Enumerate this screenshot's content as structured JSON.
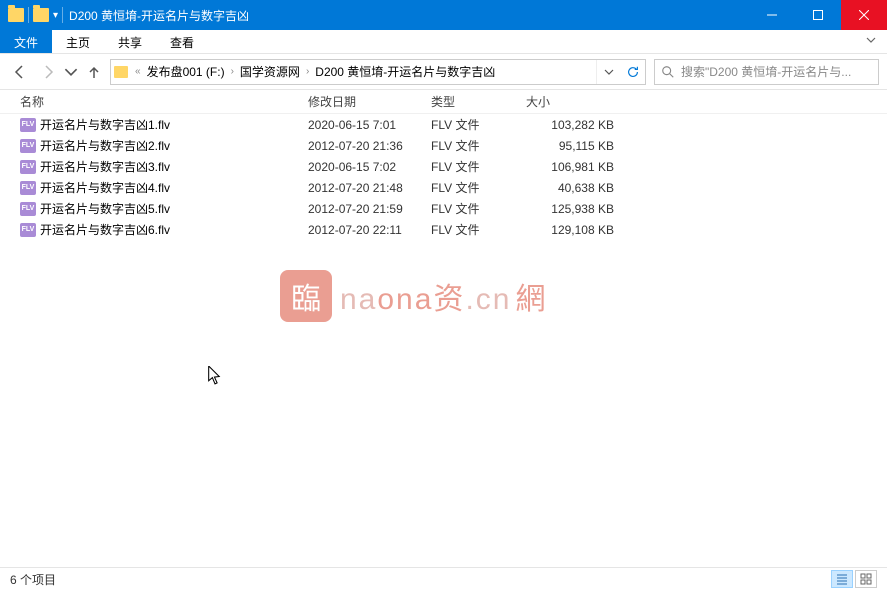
{
  "window": {
    "title": "D200 黄恒堉-开运名片与数字吉凶"
  },
  "tabs": {
    "file": "文件",
    "home": "主页",
    "share": "共享",
    "view": "查看"
  },
  "breadcrumb": {
    "prefix": "«",
    "items": [
      "发布盘001 (F:)",
      "国学资源网",
      "D200 黄恒堉-开运名片与数字吉凶"
    ]
  },
  "search": {
    "placeholder": "搜索\"D200 黄恒堉-开运名片与..."
  },
  "columns": {
    "name": "名称",
    "date": "修改日期",
    "type": "类型",
    "size": "大小"
  },
  "files": [
    {
      "name": "开运名片与数字吉凶1.flv",
      "date": "2020-06-15 7:01",
      "type": "FLV 文件",
      "size": "103,282 KB"
    },
    {
      "name": "开运名片与数字吉凶2.flv",
      "date": "2012-07-20 21:36",
      "type": "FLV 文件",
      "size": "95,115 KB"
    },
    {
      "name": "开运名片与数字吉凶3.flv",
      "date": "2020-06-15 7:02",
      "type": "FLV 文件",
      "size": "106,981 KB"
    },
    {
      "name": "开运名片与数字吉凶4.flv",
      "date": "2012-07-20 21:48",
      "type": "FLV 文件",
      "size": "40,638 KB"
    },
    {
      "name": "开运名片与数字吉凶5.flv",
      "date": "2012-07-20 21:59",
      "type": "FLV 文件",
      "size": "125,938 KB"
    },
    {
      "name": "开运名片与数字吉凶6.flv",
      "date": "2012-07-20 22:11",
      "type": "FLV 文件",
      "size": "129,108 KB"
    }
  ],
  "status": {
    "count": "6 个项目"
  },
  "watermark": {
    "seal": "臨",
    "text_a": "na",
    "text_b": "ona",
    "text_c": "资",
    "text_d": ".cn",
    "text_e": "網"
  }
}
